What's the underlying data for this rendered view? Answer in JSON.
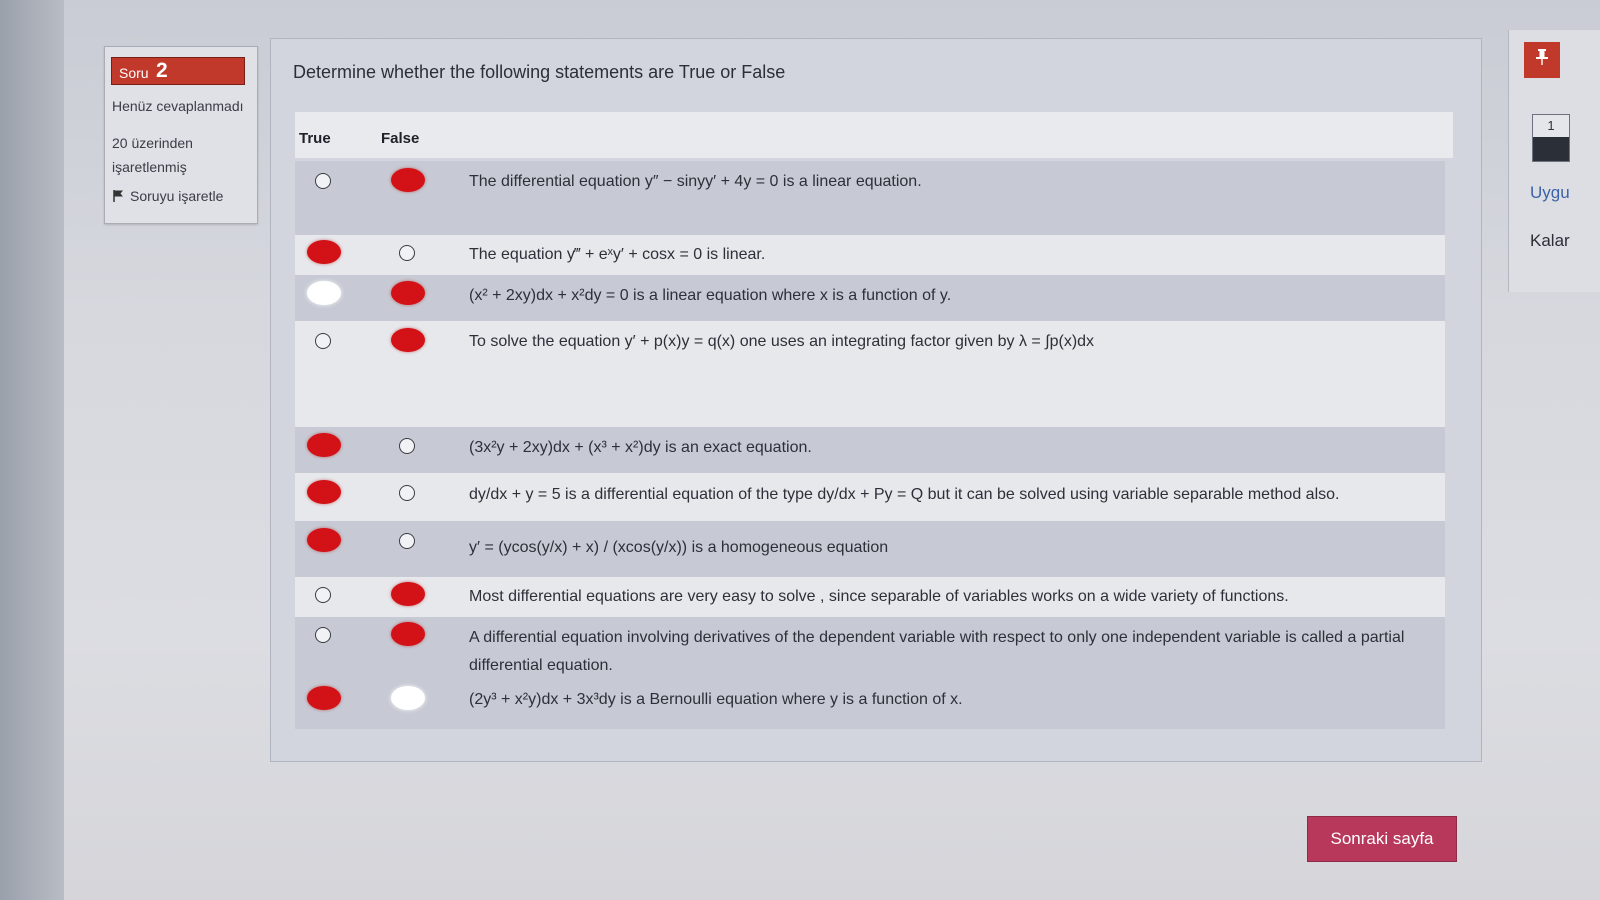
{
  "question_info": {
    "soru_label": "Soru",
    "soru_number": "2",
    "status": "Henüz cevaplanmadı",
    "marks": "20 üzerinden işaretlenmiş",
    "flag_label": "Soruyu işaretle"
  },
  "question": {
    "prompt": "Determine whether the following statements are True or False",
    "col_true": "True",
    "col_false": "False",
    "statements": [
      {
        "text": "The differential equation y″ − sinyy′ + 4y = 0 is a linear equation.",
        "true_mark": "empty",
        "false_mark": "red"
      },
      {
        "text": "The equation y‴ + eˣy′ + cosx = 0 is linear.",
        "true_mark": "red",
        "false_mark": "empty"
      },
      {
        "text": "(x² + 2xy)dx + x²dy = 0 is a linear equation where x is a function of y.",
        "true_mark": "white",
        "false_mark": "red"
      },
      {
        "text": "To solve the equation y′ + p(x)y = q(x) one uses an integrating factor given by λ = ∫p(x)dx",
        "true_mark": "empty",
        "false_mark": "red"
      },
      {
        "text": "(3x²y + 2xy)dx + (x³ + x²)dy is an exact equation.",
        "true_mark": "red",
        "false_mark": "empty"
      },
      {
        "text": "dy/dx + y = 5 is a differential equation of the type dy/dx + Py = Q but it can be solved using variable separable method also.",
        "true_mark": "red",
        "false_mark": "empty"
      },
      {
        "text": "y′ = (ycos(y/x) + x) / (xcos(y/x)) is a homogeneous equation",
        "true_mark": "red",
        "false_mark": "empty"
      },
      {
        "text": "Most differential equations are very easy to solve , since separable of variables works on a wide variety of functions.",
        "true_mark": "empty",
        "false_mark": "red"
      },
      {
        "text": "A differential equation involving derivatives of the dependent variable with respect to only one independent variable is called a partial differential equation.",
        "true_mark": "empty",
        "false_mark": "red"
      },
      {
        "text": "(2y³ + x²y)dx + 3x³dy is a Bernoulli equation where y is a function of x.",
        "true_mark": "red",
        "false_mark": "white"
      }
    ]
  },
  "sidebar": {
    "pin_icon": "pin-icon",
    "nav_number": "1",
    "uyg": "Uygu",
    "kalan": "Kalar"
  },
  "next_button": "Sonraki sayfa",
  "colors": {
    "accent_red": "#c0392b",
    "next_button": "#b7385b",
    "mark_red": "#d21217"
  }
}
